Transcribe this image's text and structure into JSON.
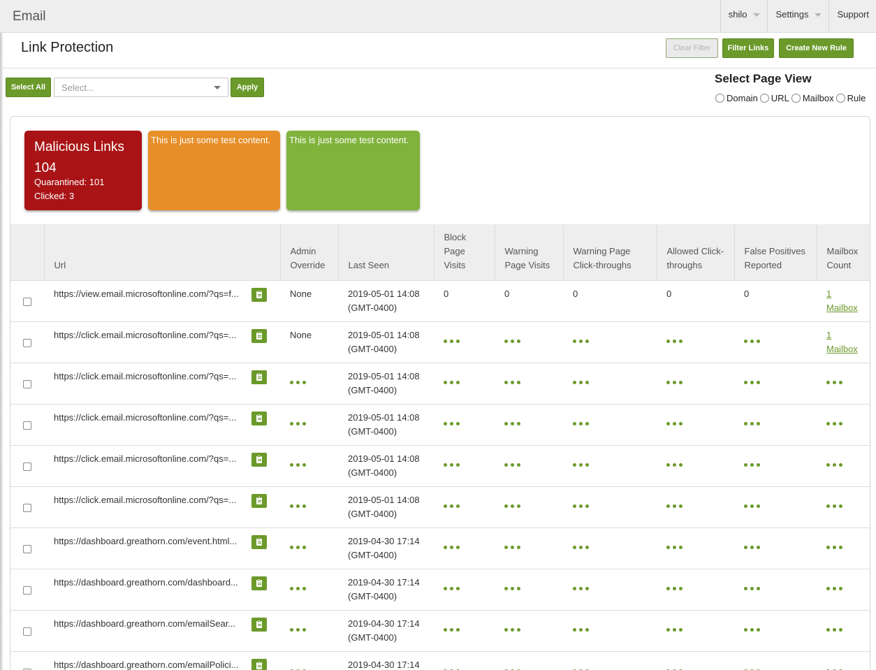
{
  "app": {
    "title": "Email"
  },
  "topnav": {
    "user": "shilo",
    "settings": "Settings",
    "support": "Support"
  },
  "page": {
    "title": "Link Protection"
  },
  "actions": {
    "clear_filter": "Clear Filter",
    "filter_links": "Filter Links",
    "create_rule": "Create New Rule"
  },
  "toolbar": {
    "select_all": "Select All",
    "select_placeholder": "Select...",
    "apply": "Apply"
  },
  "page_view": {
    "title": "Select Page View",
    "options": [
      "Domain",
      "URL",
      "Mailbox",
      "Rule"
    ]
  },
  "cards": {
    "malicious": {
      "title": "Malicious Links",
      "count": "104",
      "quarantined": "Quarantined: 101",
      "clicked": "Clicked: 3"
    },
    "orange_text": "This is just some test content.",
    "green_text": "This is just some test content."
  },
  "table": {
    "headers": [
      "Url",
      "Admin Override",
      "Last Seen",
      "Block Page Visits",
      "Warning Page Visits",
      "Warning Page Click-throughs",
      "Allowed Click-throughs",
      "False Positives Reported",
      "Mailbox Count"
    ],
    "rows": [
      {
        "url": "https://view.email.microsoftonline.com/?qs=f...",
        "admin_override": "None",
        "last_seen": "2019-05-01 14:08",
        "tz": "(GMT-0400)",
        "block": "0",
        "warn_visits": "0",
        "warn_click": "0",
        "allowed": "0",
        "false_pos": "0",
        "mailbox_num": "1",
        "mailbox_word": "Mailbox"
      },
      {
        "url": "https://click.email.microsoftonline.com/?qs=...",
        "admin_override": "None",
        "last_seen": "2019-05-01 14:08",
        "tz": "(GMT-0400)",
        "mailbox_num": "1",
        "mailbox_word": "Mailbox"
      },
      {
        "url": "https://click.email.microsoftonline.com/?qs=...",
        "last_seen": "2019-05-01 14:08",
        "tz": "(GMT-0400)"
      },
      {
        "url": "https://click.email.microsoftonline.com/?qs=...",
        "last_seen": "2019-05-01 14:08",
        "tz": "(GMT-0400)"
      },
      {
        "url": "https://click.email.microsoftonline.com/?qs=...",
        "last_seen": "2019-05-01 14:08",
        "tz": "(GMT-0400)"
      },
      {
        "url": "https://click.email.microsoftonline.com/?qs=...",
        "last_seen": "2019-05-01 14:08",
        "tz": "(GMT-0400)"
      },
      {
        "url": "https://dashboard.greathorn.com/event.html...",
        "last_seen": "2019-04-30 17:14",
        "tz": "(GMT-0400)"
      },
      {
        "url": "https://dashboard.greathorn.com/dashboard...",
        "last_seen": "2019-04-30 17:14",
        "tz": "(GMT-0400)"
      },
      {
        "url": "https://dashboard.greathorn.com/emailSear...",
        "last_seen": "2019-04-30 17:14",
        "tz": "(GMT-0400)"
      },
      {
        "url": "https://dashboard.greathorn.com/emailPolici...",
        "last_seen": "2019-04-30 17:14",
        "tz": ""
      }
    ]
  },
  "colors": {
    "accent_green": "#6b9a2a",
    "card_red": "#a91315",
    "card_orange": "#e78f28",
    "card_green": "#80b33c"
  }
}
